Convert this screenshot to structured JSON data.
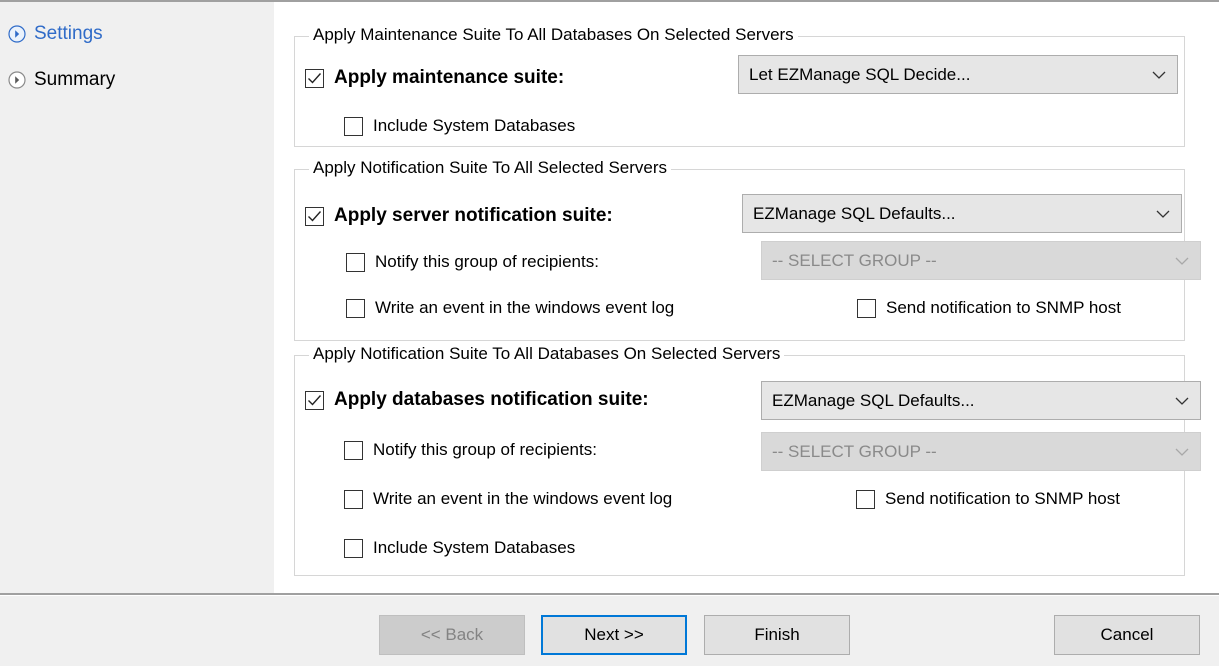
{
  "nav": {
    "items": [
      {
        "label": "Settings",
        "active": true
      },
      {
        "label": "Summary",
        "active": false
      }
    ]
  },
  "maintenance": {
    "title": "Apply Maintenance Suite To All Databases On Selected Servers",
    "apply_label": "Apply maintenance suite:",
    "apply_checked": true,
    "suite_value": "Let EZManage SQL Decide...",
    "include_system_label": "Include System Databases",
    "include_system_checked": false
  },
  "server_notification": {
    "title": "Apply Notification Suite To All Selected Servers",
    "apply_label": "Apply server notification suite:",
    "apply_checked": true,
    "suite_value": "EZManage SQL Defaults...",
    "notify_group_label": "Notify this group of recipients:",
    "notify_group_checked": false,
    "group_value": "-- SELECT GROUP --",
    "event_log_label": "Write an event in the windows event log",
    "event_log_checked": false,
    "snmp_label": "Send notification to SNMP host",
    "snmp_checked": false
  },
  "database_notification": {
    "title": "Apply Notification Suite To All Databases On Selected Servers",
    "apply_label": "Apply databases notification suite:",
    "apply_checked": true,
    "suite_value": "EZManage SQL Defaults...",
    "notify_group_label": "Notify this group of recipients:",
    "notify_group_checked": false,
    "group_value": "-- SELECT GROUP --",
    "event_log_label": "Write an event in the windows event log",
    "event_log_checked": false,
    "snmp_label": "Send notification to SNMP host",
    "snmp_checked": false,
    "include_system_label": "Include System Databases",
    "include_system_checked": false
  },
  "footer": {
    "back_label": "<< Back",
    "next_label": "Next >>",
    "finish_label": "Finish",
    "cancel_label": "Cancel"
  },
  "colors": {
    "accent": "#0078d7",
    "nav_active": "#2f6bc8",
    "panel_bg": "#f0f0f0"
  },
  "icons": {
    "nav_item": "circle-chevron-right-icon",
    "checkbox_checked": "checkmark-icon",
    "combo_dropdown": "chevron-down-icon"
  }
}
